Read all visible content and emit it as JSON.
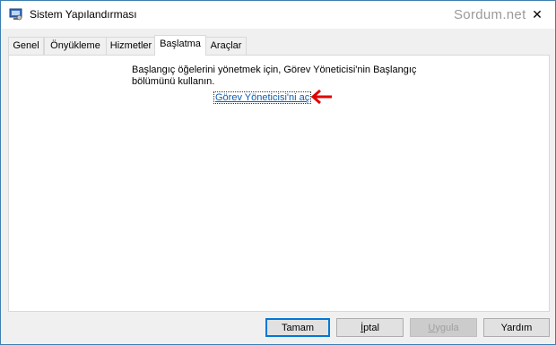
{
  "window": {
    "title": "Sistem Yapılandırması",
    "watermark": "Sordum.net",
    "close_glyph": "✕"
  },
  "tabs": [
    {
      "label": "Genel",
      "active": false
    },
    {
      "label": "Önyükleme",
      "active": false
    },
    {
      "label": "Hizmetler",
      "active": false
    },
    {
      "label": "Başlatma",
      "active": true
    },
    {
      "label": "Araçlar",
      "active": false
    }
  ],
  "startup": {
    "description": "Başlangıç öğelerini yönetmek için, Görev Yöneticisi'nin Başlangıç bölümünü kullanın.",
    "link": "Görev Yöneticisi'ni aç",
    "arrow_color": "#e00000"
  },
  "buttons": {
    "ok": "Tamam",
    "cancel_first": "İ",
    "cancel_rest": "ptal",
    "apply_first": "U",
    "apply_rest": "ygula",
    "help": "Yardım"
  },
  "colors": {
    "accent": "#0078d7",
    "link": "#0a5db5"
  }
}
